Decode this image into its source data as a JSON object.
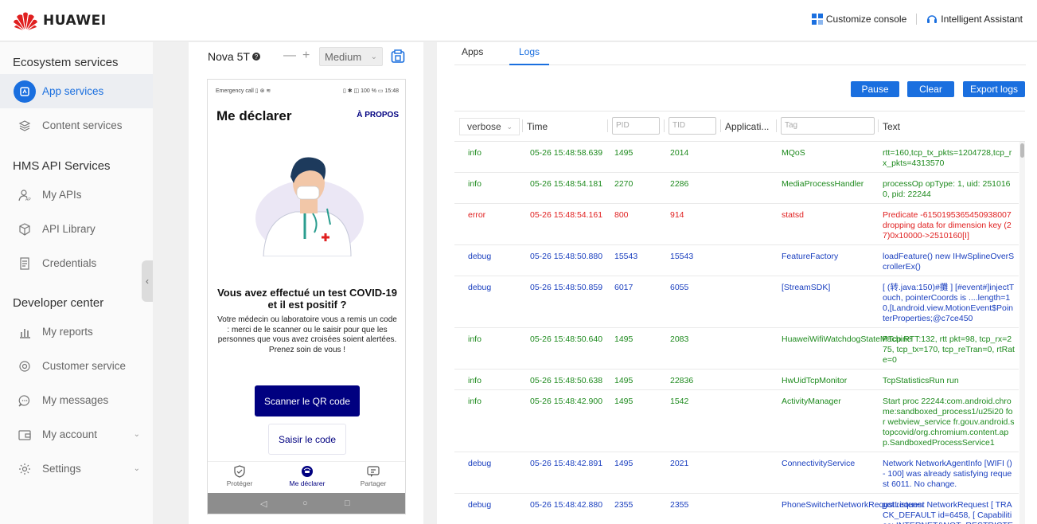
{
  "brand": {
    "logo_text": "HUAWEI",
    "logo_color": "#e02020"
  },
  "header": {
    "customize_label": "Customize console",
    "assistant_label": "Intelligent Assistant"
  },
  "sidebar": {
    "groups": [
      {
        "label": "Ecosystem services"
      },
      {
        "label": "HMS API Services"
      },
      {
        "label": "Developer center"
      }
    ],
    "items": [
      {
        "label": "App services",
        "icon": "app-services-icon",
        "active": true
      },
      {
        "label": "Content services",
        "icon": "layers-icon"
      },
      {
        "label": "My APIs",
        "icon": "api-user-icon"
      },
      {
        "label": "API Library",
        "icon": "cube-icon"
      },
      {
        "label": "Credentials",
        "icon": "document-icon"
      },
      {
        "label": "My reports",
        "icon": "bar-chart-icon"
      },
      {
        "label": "Customer service",
        "icon": "headset-icon"
      },
      {
        "label": "My messages",
        "icon": "chat-icon"
      },
      {
        "label": "My account",
        "icon": "wallet-icon"
      },
      {
        "label": "Settings",
        "icon": "gear-icon"
      }
    ]
  },
  "device": {
    "name": "Nova 5T",
    "zoom_minus": "—",
    "zoom_plus": "+",
    "zoom_value": "Medium",
    "accent": "#1a6fdf"
  },
  "phone": {
    "status_left": "Emergency call  ▯ ⊛ ≋",
    "status_right": "▯ ✱ ◫ 100 % ▭ 15:48",
    "app_title": "Me déclarer",
    "app_link": "À PROPOS",
    "headline": "Vous avez effectué un test COVID-19 et il est positif ?",
    "body": "Votre médecin ou laboratoire vous a remis un code : merci de le scanner ou le saisir pour que les personnes que vous avez croisées soient alertées.\nPrenez soin de vous !",
    "btn_scan": "Scanner le QR code",
    "btn_code": "Saisir le code",
    "tabs": [
      {
        "label": "Protéger",
        "icon": "shield-check-icon"
      },
      {
        "label": "Me déclarer",
        "icon": "doctor-icon",
        "active": true
      },
      {
        "label": "Partager",
        "icon": "share-chat-icon"
      }
    ],
    "nav": [
      "◁",
      "○",
      "□"
    ],
    "brand_color": "#000080"
  },
  "main": {
    "tabs": [
      {
        "label": "Apps"
      },
      {
        "label": "Logs",
        "active": true
      }
    ],
    "actions": {
      "pause": "Pause",
      "clear": "Clear",
      "export": "Export logs"
    },
    "filters": {
      "level": "verbose",
      "time": "Time",
      "pid_placeholder": "PID",
      "tid_placeholder": "TID",
      "application": "Applicati...",
      "tag_placeholder": "Tag",
      "text": "Text"
    },
    "logs": [
      {
        "level": "info",
        "time": "05-26 15:48:58.639",
        "pid": "1495",
        "tid": "2014",
        "app": "MQoS",
        "text": "rtt=160,tcp_tx_pkts=1204728,tcp_rx_pkts=4313570"
      },
      {
        "level": "info",
        "time": "05-26 15:48:54.181",
        "pid": "2270",
        "tid": "2286",
        "app": "MediaProcessHandler",
        "text": "processOp opType: 1, uid: 251016 0, pid: 22244"
      },
      {
        "level": "error",
        "time": "05-26 15:48:54.161",
        "pid": "800",
        "tid": "914",
        "app": "statsd",
        "text": "Predicate -6150195365450938007 dropping data for dimension key (27)0x10000->2510160[I]"
      },
      {
        "level": "debug",
        "time": "05-26 15:48:50.880",
        "pid": "15543",
        "tid": "15543",
        "app": "FeatureFactory",
        "text": "loadFeature() new IHwSplineOverScrollerEx()"
      },
      {
        "level": "debug",
        "time": "05-26 15:48:50.859",
        "pid": "6017",
        "tid": "6055",
        "app": "[StreamSDK]",
        "text": "[ (转.java:150)#攤 ] [#event#]injectTouch, pointerCoords is ....length=10,[Landroid.view.MotionEvent$PointerProperties;@c7ce450"
      },
      {
        "level": "info",
        "time": "05-26 15:48:50.640",
        "pid": "1495",
        "tid": "2083",
        "app": "HuaweiWifiWatchdogStateMachine",
        "text": "PTcp RTT:132, rtt pkt=98, tcp_rx=275, tcp_tx=170, tcp_reTran=0, rtRate=0"
      },
      {
        "level": "info",
        "time": "05-26 15:48:50.638",
        "pid": "1495",
        "tid": "22836",
        "app": "HwUidTcpMonitor",
        "text": "TcpStatisticsRun run"
      },
      {
        "level": "info",
        "time": "05-26 15:48:42.900",
        "pid": "1495",
        "tid": "1542",
        "app": "ActivityManager",
        "text": "Start proc 22244:com.android.chrome:sandboxed_process1/u25i20 for webview_service fr.gouv.android.stopcovid/org.chromium.content.app.SandboxedProcessService1"
      },
      {
        "level": "debug",
        "time": "05-26 15:48:42.891",
        "pid": "1495",
        "tid": "2021",
        "app": "ConnectivityService",
        "text": "Network NetworkAgentInfo [WIFI () - 100] was already satisfying request 6011. No change."
      },
      {
        "level": "debug",
        "time": "05-26 15:48:42.880",
        "pid": "2355",
        "tid": "2355",
        "app": "PhoneSwitcherNetworkRequstListener",
        "text": "got request NetworkRequest [ TRACK_DEFAULT id=6458, [ Capabilities: INTERNET&NOT_RESTRICTED&T"
      }
    ]
  }
}
